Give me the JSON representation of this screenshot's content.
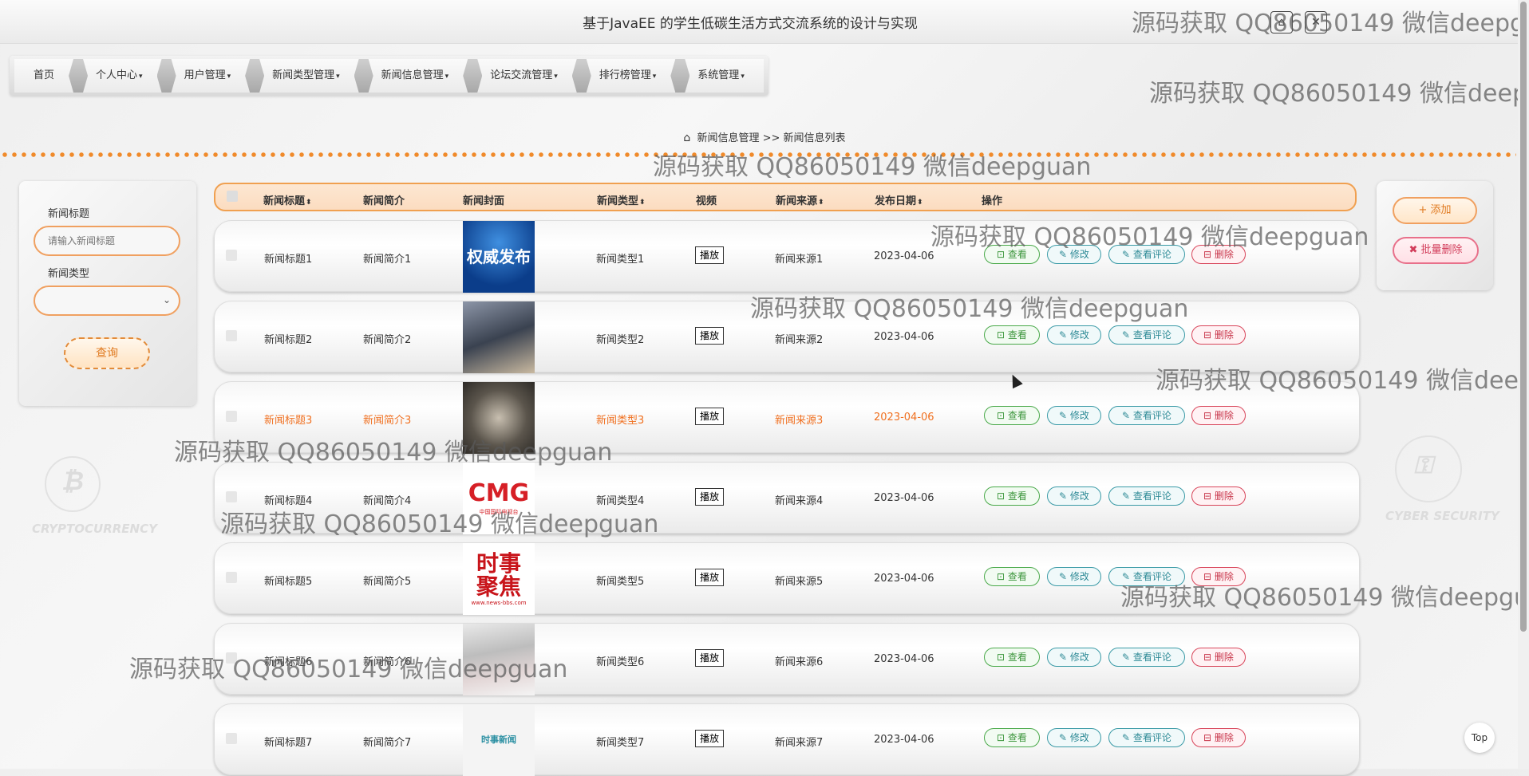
{
  "app": {
    "title": "基于JavaEE 的学生低碳生活方式交流系统的设计与实现",
    "window_buttons": [
      "⌂",
      "✕"
    ]
  },
  "nav": {
    "items": [
      {
        "label": "首页",
        "has_caret": false
      },
      {
        "label": "个人中心",
        "has_caret": true
      },
      {
        "label": "用户管理",
        "has_caret": true
      },
      {
        "label": "新闻类型管理",
        "has_caret": true
      },
      {
        "label": "新闻信息管理",
        "has_caret": true
      },
      {
        "label": "论坛交流管理",
        "has_caret": true
      },
      {
        "label": "排行榜管理",
        "has_caret": true
      },
      {
        "label": "系统管理",
        "has_caret": true
      }
    ]
  },
  "breadcrumb": {
    "parent": "新闻信息管理",
    "separator": ">>",
    "current": "新闻信息列表"
  },
  "search": {
    "title_label": "新闻标题",
    "title_placeholder": "请输入新闻标题",
    "type_label": "新闻类型",
    "type_value": "",
    "query_label": "查询"
  },
  "actions": {
    "add_label": "+ 添加",
    "batch_delete_label": "✖ 批量删除"
  },
  "table": {
    "columns": [
      "新闻标题",
      "新闻简介",
      "新闻封面",
      "新闻类型",
      "视频",
      "新闻来源",
      "发布日期",
      "操作"
    ],
    "sortable": [
      true,
      false,
      false,
      true,
      false,
      true,
      true,
      false
    ],
    "row_actions": {
      "view": "查看",
      "edit": "修改",
      "comment": "查看评论",
      "delete": "删除"
    },
    "play_label": "播放",
    "rows": [
      {
        "title": "新闻标题1",
        "summary": "新闻简介1",
        "cover": "cover-1",
        "type": "新闻类型1",
        "source": "新闻来源1",
        "date": "2023-04-06",
        "highlighted": false
      },
      {
        "title": "新闻标题2",
        "summary": "新闻简介2",
        "cover": "cover-2",
        "type": "新闻类型2",
        "source": "新闻来源2",
        "date": "2023-04-06",
        "highlighted": false
      },
      {
        "title": "新闻标题3",
        "summary": "新闻简介3",
        "cover": "cover-3",
        "type": "新闻类型3",
        "source": "新闻来源3",
        "date": "2023-04-06",
        "highlighted": true
      },
      {
        "title": "新闻标题4",
        "summary": "新闻简介4",
        "cover": "cover-4",
        "type": "新闻类型4",
        "source": "新闻来源4",
        "date": "2023-04-06",
        "highlighted": false
      },
      {
        "title": "新闻标题5",
        "summary": "新闻简介5",
        "cover": "cover-5",
        "type": "新闻类型5",
        "source": "新闻来源5",
        "date": "2023-04-06",
        "highlighted": false
      },
      {
        "title": "新闻标题6",
        "summary": "新闻简介6",
        "cover": "cover-6",
        "type": "新闻类型6",
        "source": "新闻来源6",
        "date": "2023-04-06",
        "highlighted": false
      },
      {
        "title": "新闻标题7",
        "summary": "新闻简介7",
        "cover": "cover-7",
        "type": "新闻类型7",
        "source": "新闻来源7",
        "date": "2023-04-06",
        "highlighted": false
      }
    ]
  },
  "covers": {
    "cover-1": {
      "text": "权威发布"
    },
    "cover-2": {
      "text": ""
    },
    "cover-3": {
      "text": ""
    },
    "cover-4": {
      "text": "CMG",
      "subtext": "中国国际电视台"
    },
    "cover-5": {
      "text": "时事聚焦",
      "subtext": "www.news-bbs.com"
    },
    "cover-6": {
      "text": ""
    },
    "cover-7": {
      "text": "时事新闻"
    }
  },
  "background": {
    "crypto_label": "CRYPTOCURRENCY",
    "security_label": "CYBER SECURITY"
  },
  "watermark": "源码获取 QQ86050149 微信deepguan",
  "scroll_top_label": "Top",
  "colors": {
    "accent": "#f08a2a",
    "highlight_text": "#f07020",
    "view_green": "#3c963c",
    "edit_teal": "#2e8a96",
    "delete_red": "#c8354a"
  }
}
